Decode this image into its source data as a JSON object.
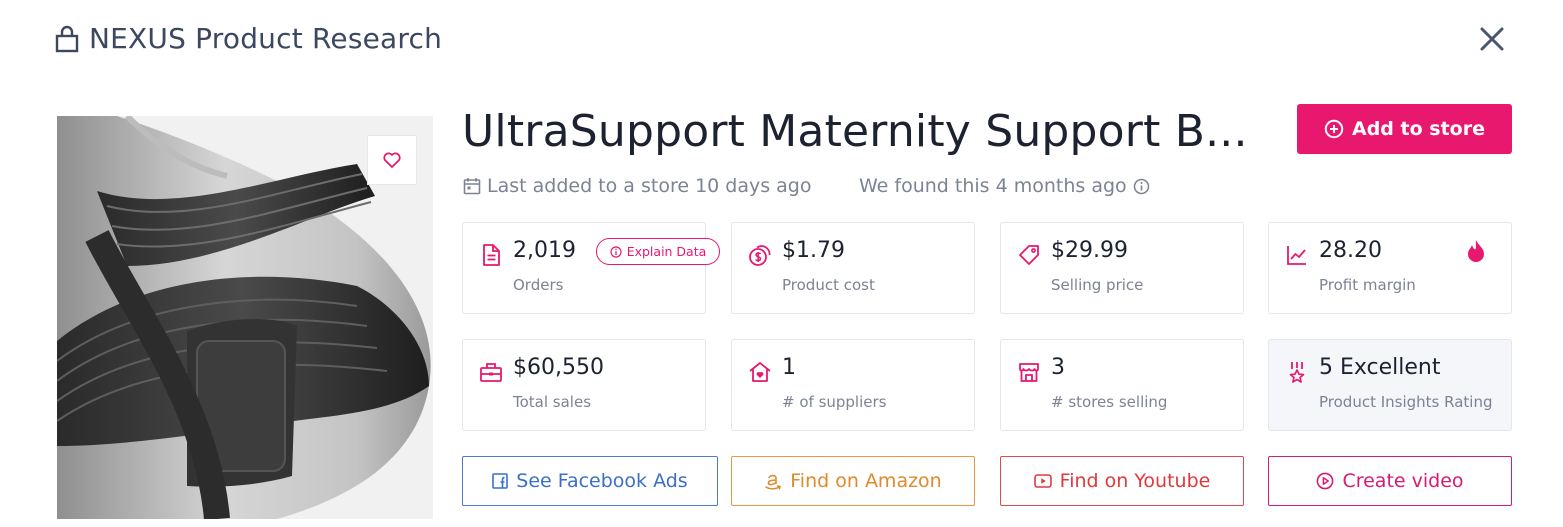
{
  "header": {
    "title": "NEXUS Product Research"
  },
  "product": {
    "title": "UltraSupport Maternity Support B...",
    "last_added": "Last added to a store 10 days ago",
    "found": "We found this 4 months ago"
  },
  "actions": {
    "add_to_store": "Add to store",
    "explain_data": "Explain Data"
  },
  "stats": [
    {
      "value": "2,019",
      "label": "Orders",
      "icon": "document-icon"
    },
    {
      "value": "$1.79",
      "label": "Product cost",
      "icon": "coins-icon"
    },
    {
      "value": "$29.99",
      "label": "Selling price",
      "icon": "price-tag-icon"
    },
    {
      "value": "28.20",
      "label": "Profit margin",
      "icon": "trend-chart-icon"
    },
    {
      "value": "$60,550",
      "label": "Total sales",
      "icon": "register-icon"
    },
    {
      "value": "1",
      "label": "# of suppliers",
      "icon": "supplier-home-icon"
    },
    {
      "value": "3",
      "label": "# stores selling",
      "icon": "store-icon"
    },
    {
      "value": "5 Excellent",
      "label": "Product Insights Rating",
      "icon": "award-icon"
    }
  ],
  "buttons": {
    "facebook": "See Facebook Ads",
    "amazon": "Find on Amazon",
    "youtube": "Find on Youtube",
    "video": "Create video"
  },
  "colors": {
    "accent": "#e8186f",
    "facebook": "#3b6fc8",
    "amazon": "#e08a2c",
    "youtube": "#e0393d",
    "text_muted": "#7b8394"
  }
}
